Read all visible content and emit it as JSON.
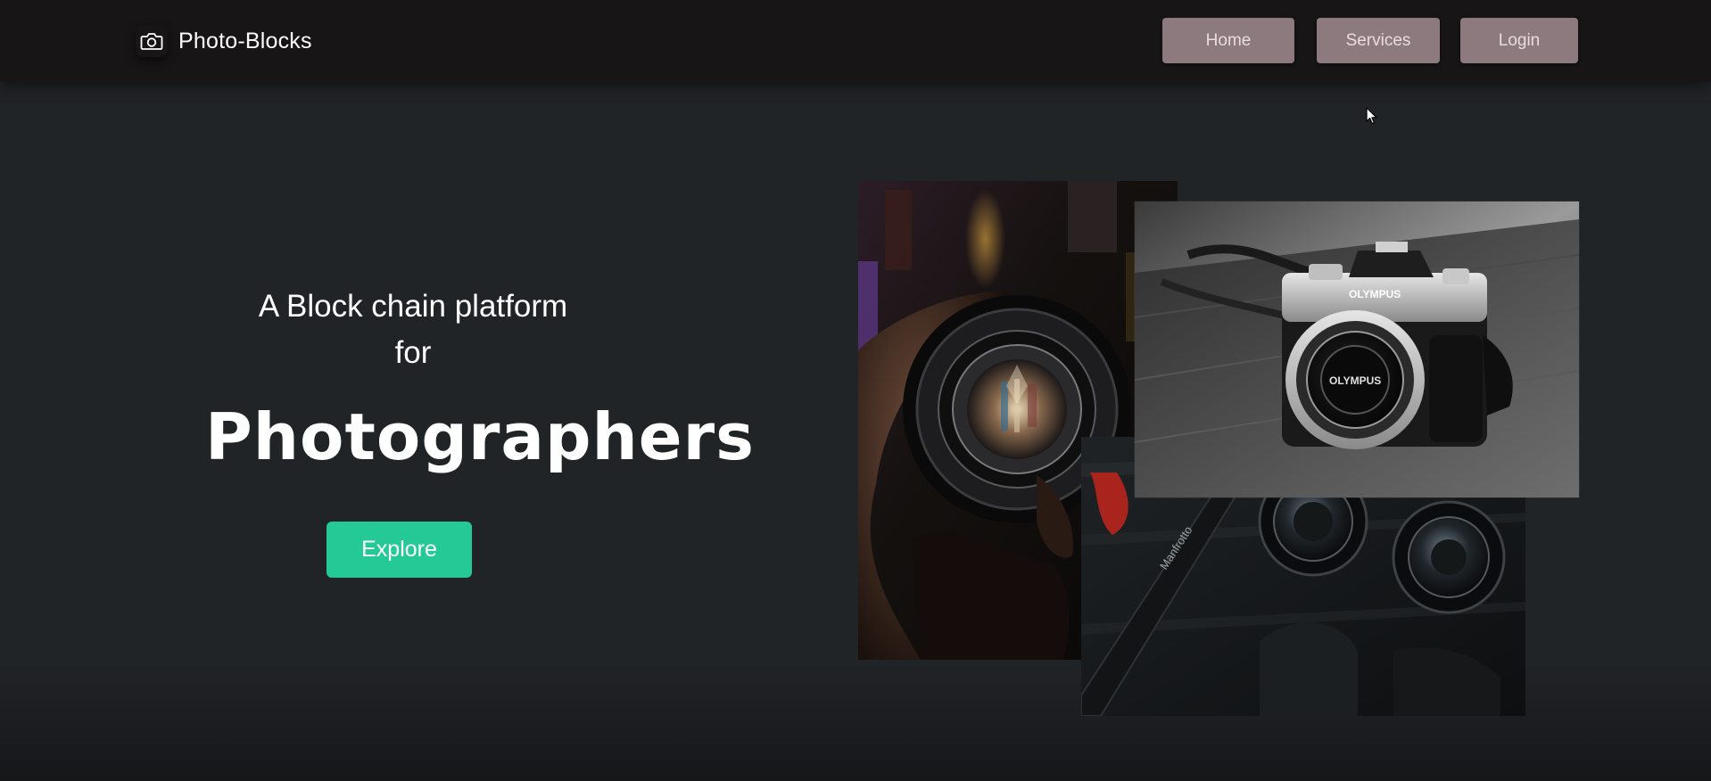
{
  "navbar": {
    "brand": {
      "icon": "camera-icon",
      "name": "Photo-Blocks"
    },
    "links": [
      {
        "label": "Home"
      },
      {
        "label": "Services"
      },
      {
        "label": "Login"
      }
    ],
    "button_color": "#8c7a7e"
  },
  "hero": {
    "subtitle_line1": "A Block chain platform",
    "subtitle_line2": "for",
    "title": "Photographers",
    "cta_label": "Explore",
    "cta_color": "#24c996"
  },
  "gallery": {
    "images": [
      {
        "subject": "hand-holding-lens-photo"
      },
      {
        "subject": "olympus-camera-photo",
        "visible_text": "OLYMPUS"
      },
      {
        "subject": "camera-lenses-photo",
        "visible_text": "Manfrotto"
      }
    ]
  },
  "colors": {
    "background": "#212427",
    "navbar": "#171516",
    "accent": "#24c996"
  }
}
